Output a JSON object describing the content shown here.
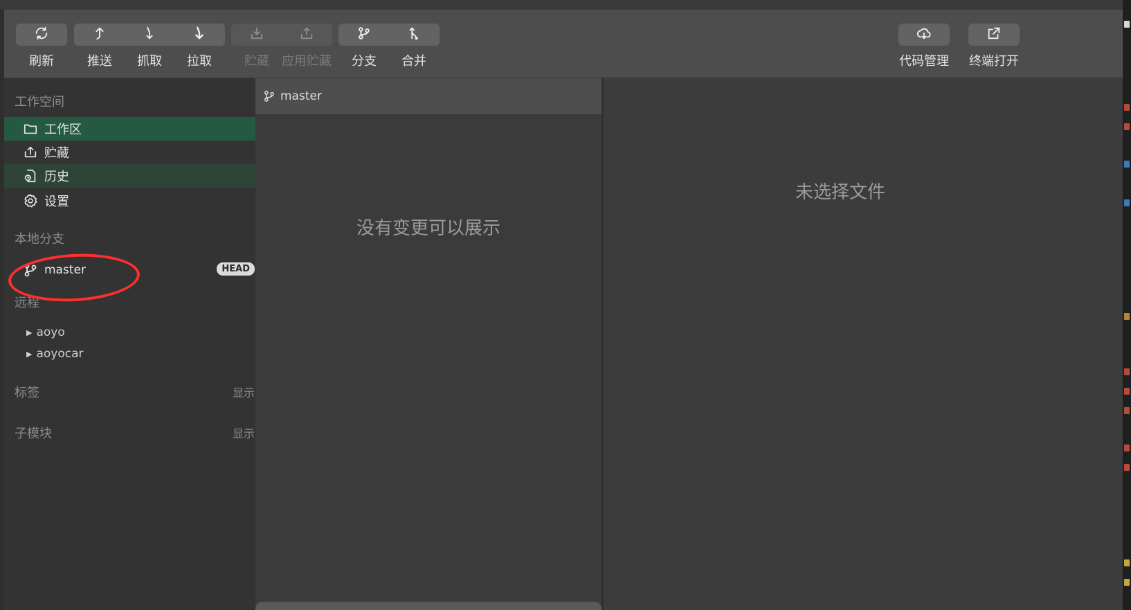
{
  "toolbar": {
    "buttons": [
      {
        "label": "刷新",
        "icon": "refresh-icon",
        "enabled": true
      },
      {
        "label": "推送",
        "icon": "push-icon",
        "enabled": true
      },
      {
        "label": "抓取",
        "icon": "fetch-icon",
        "enabled": true
      },
      {
        "label": "拉取",
        "icon": "pull-icon",
        "enabled": true
      },
      {
        "label": "贮藏",
        "icon": "stash-icon",
        "enabled": false
      },
      {
        "label": "应用贮藏",
        "icon": "apply-stash-icon",
        "enabled": false
      },
      {
        "label": "分支",
        "icon": "branch-icon",
        "enabled": true
      },
      {
        "label": "合并",
        "icon": "merge-icon",
        "enabled": true
      },
      {
        "label": "代码管理",
        "icon": "cloud-sync-icon",
        "enabled": true
      },
      {
        "label": "终端打开",
        "icon": "external-link-icon",
        "enabled": true
      }
    ]
  },
  "sidebar": {
    "workspace_title": "工作空间",
    "workspace_items": [
      {
        "label": "工作区",
        "icon": "folder-icon",
        "state": "active"
      },
      {
        "label": "贮藏",
        "icon": "stash-icon",
        "state": "normal"
      },
      {
        "label": "历史",
        "icon": "history-icon",
        "state": "hover"
      },
      {
        "label": "设置",
        "icon": "gear-icon",
        "state": "normal"
      }
    ],
    "local_branches_title": "本地分支",
    "local_branches": [
      {
        "name": "master",
        "badge": "HEAD"
      }
    ],
    "remote_title": "远程",
    "remotes": [
      "aoyo",
      "aoyocar"
    ],
    "tags_title": "标签",
    "tags_action": "显示",
    "submodules_title": "子模块",
    "submodules_action": "显示"
  },
  "changes_panel": {
    "branch": "master",
    "empty_message": "没有变更可以展示"
  },
  "diff_panel": {
    "empty_message": "未选择文件"
  },
  "colors": {
    "accent_active": "#255a42",
    "highlight_ring": "#ff2f2f"
  }
}
